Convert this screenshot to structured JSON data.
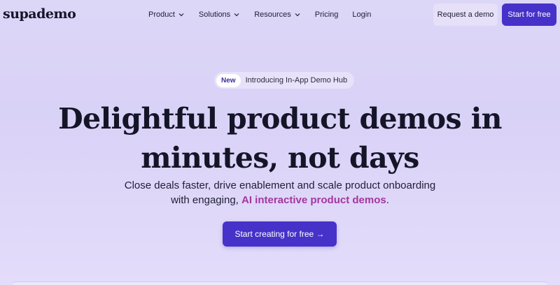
{
  "brand": {
    "logo_text": "supademo"
  },
  "nav": {
    "items": [
      {
        "label": "Product",
        "has_dropdown": true
      },
      {
        "label": "Solutions",
        "has_dropdown": true
      },
      {
        "label": "Resources",
        "has_dropdown": true
      },
      {
        "label": "Pricing",
        "has_dropdown": false
      },
      {
        "label": "Login",
        "has_dropdown": false
      }
    ],
    "request_demo_label": "Request a demo",
    "start_free_label": "Start for free"
  },
  "announcement": {
    "badge": "New",
    "text": "Introducing In-App Demo Hub"
  },
  "hero": {
    "headline_line1": "Delightful product demos in",
    "headline_line2": "minutes, not days",
    "subtitle_line1": "Close deals faster, drive enablement and scale product onboarding",
    "subtitle_line2_prefix": "with engaging, ",
    "subtitle_highlight": "AI interactive product demos",
    "subtitle_line2_suffix": ".",
    "cta_label": "Start creating for free →"
  },
  "colors": {
    "accent": "#4632c8",
    "highlight": "#a3379e",
    "background": "#dcd6f7"
  }
}
